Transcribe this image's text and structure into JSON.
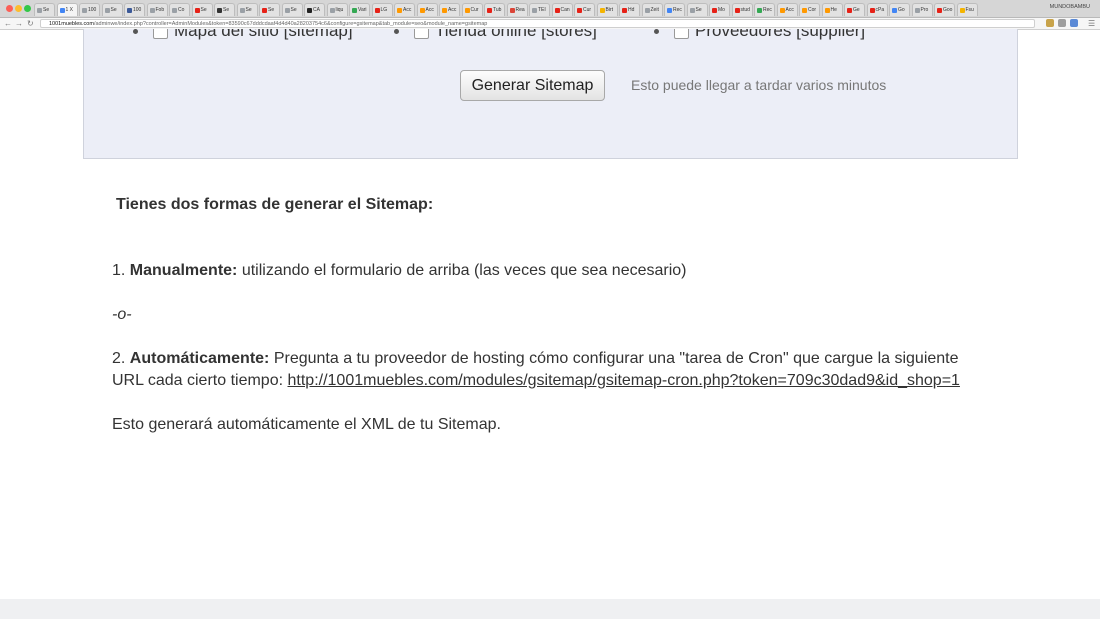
{
  "browser": {
    "url_domain": "1001muebles.com",
    "url_path": "/adminwe/index.php?controller=AdminModules&token=83590c67dddcdaaf4d4d40a28203754c6&configure=gsitemap&tab_module=seo&module_name=gsitemap",
    "profile_name": "MUNDOBAMBU",
    "tabs": [
      "Se",
      "1 X",
      "100",
      "Se",
      "100",
      "Fob",
      "Co",
      "Se",
      "Se",
      "Se",
      "Se",
      "Se",
      "CA",
      "liqu",
      "Vari",
      "LG",
      "Acc",
      "Acc",
      "Acc",
      "Cur",
      "Tub",
      "Rea",
      "TEI",
      "Can",
      "Cur",
      "Birt",
      "Hd",
      "Zeit",
      "Rec",
      "Se",
      "Mo",
      "stud",
      "Rec",
      "Acc",
      "Cor",
      "He",
      "Ge",
      "cPa",
      "Go",
      "Pro",
      "Goo",
      "Fsu"
    ],
    "tab_colors": [
      "#9aa0a6",
      "#4285f4",
      "#9aa0a6",
      "#9aa0a6",
      "#3b5998",
      "#9aa0a6",
      "#9aa0a6",
      "#e62117",
      "#333333",
      "#9aa0a6",
      "#e62117",
      "#9aa0a6",
      "#222222",
      "#9aa0a6",
      "#34a853",
      "#e62117",
      "#ff9900",
      "#ff9900",
      "#ff9900",
      "#ff9900",
      "#e62117",
      "#db4437",
      "#9aa0a6",
      "#e62117",
      "#e62117",
      "#f4b400",
      "#e62117",
      "#9aa0a6",
      "#4285f4",
      "#9aa0a6",
      "#e62117",
      "#e62117",
      "#34a853",
      "#ff9900",
      "#ff9900",
      "#ff9900",
      "#e62117",
      "#e62117",
      "#4285f4",
      "#9aa0a6",
      "#e62117",
      "#f4b400"
    ]
  },
  "panel": {
    "checkboxes": [
      {
        "label": "Mapa del sitio [sitemap]",
        "checked": false
      },
      {
        "label": "Tienda online [stores]",
        "checked": false
      },
      {
        "label": "Proveedores [supplier]",
        "checked": false
      }
    ],
    "generate_button": "Generar Sitemap",
    "generate_hint": "Esto puede llegar a tardar varios minutos"
  },
  "content": {
    "heading": "Tienes dos formas de generar el Sitemap:",
    "option1_num": "1.",
    "option1_bold": "Manualmente:",
    "option1_text": "utilizando el formulario de arriba (las veces que sea necesario)",
    "separator": "-o-",
    "option2_num": "2.",
    "option2_bold": "Automáticamente:",
    "option2_text": "Pregunta a tu proveedor de hosting cómo configurar una \"tarea de Cron\" que cargue la siguiente URL cada cierto tiempo:",
    "cron_url": "http://1001muebles.com/modules/gsitemap/gsitemap-cron.php?token=709c30dad9&id_shop=1",
    "closing": "Esto generará automáticamente el XML de tu Sitemap."
  }
}
